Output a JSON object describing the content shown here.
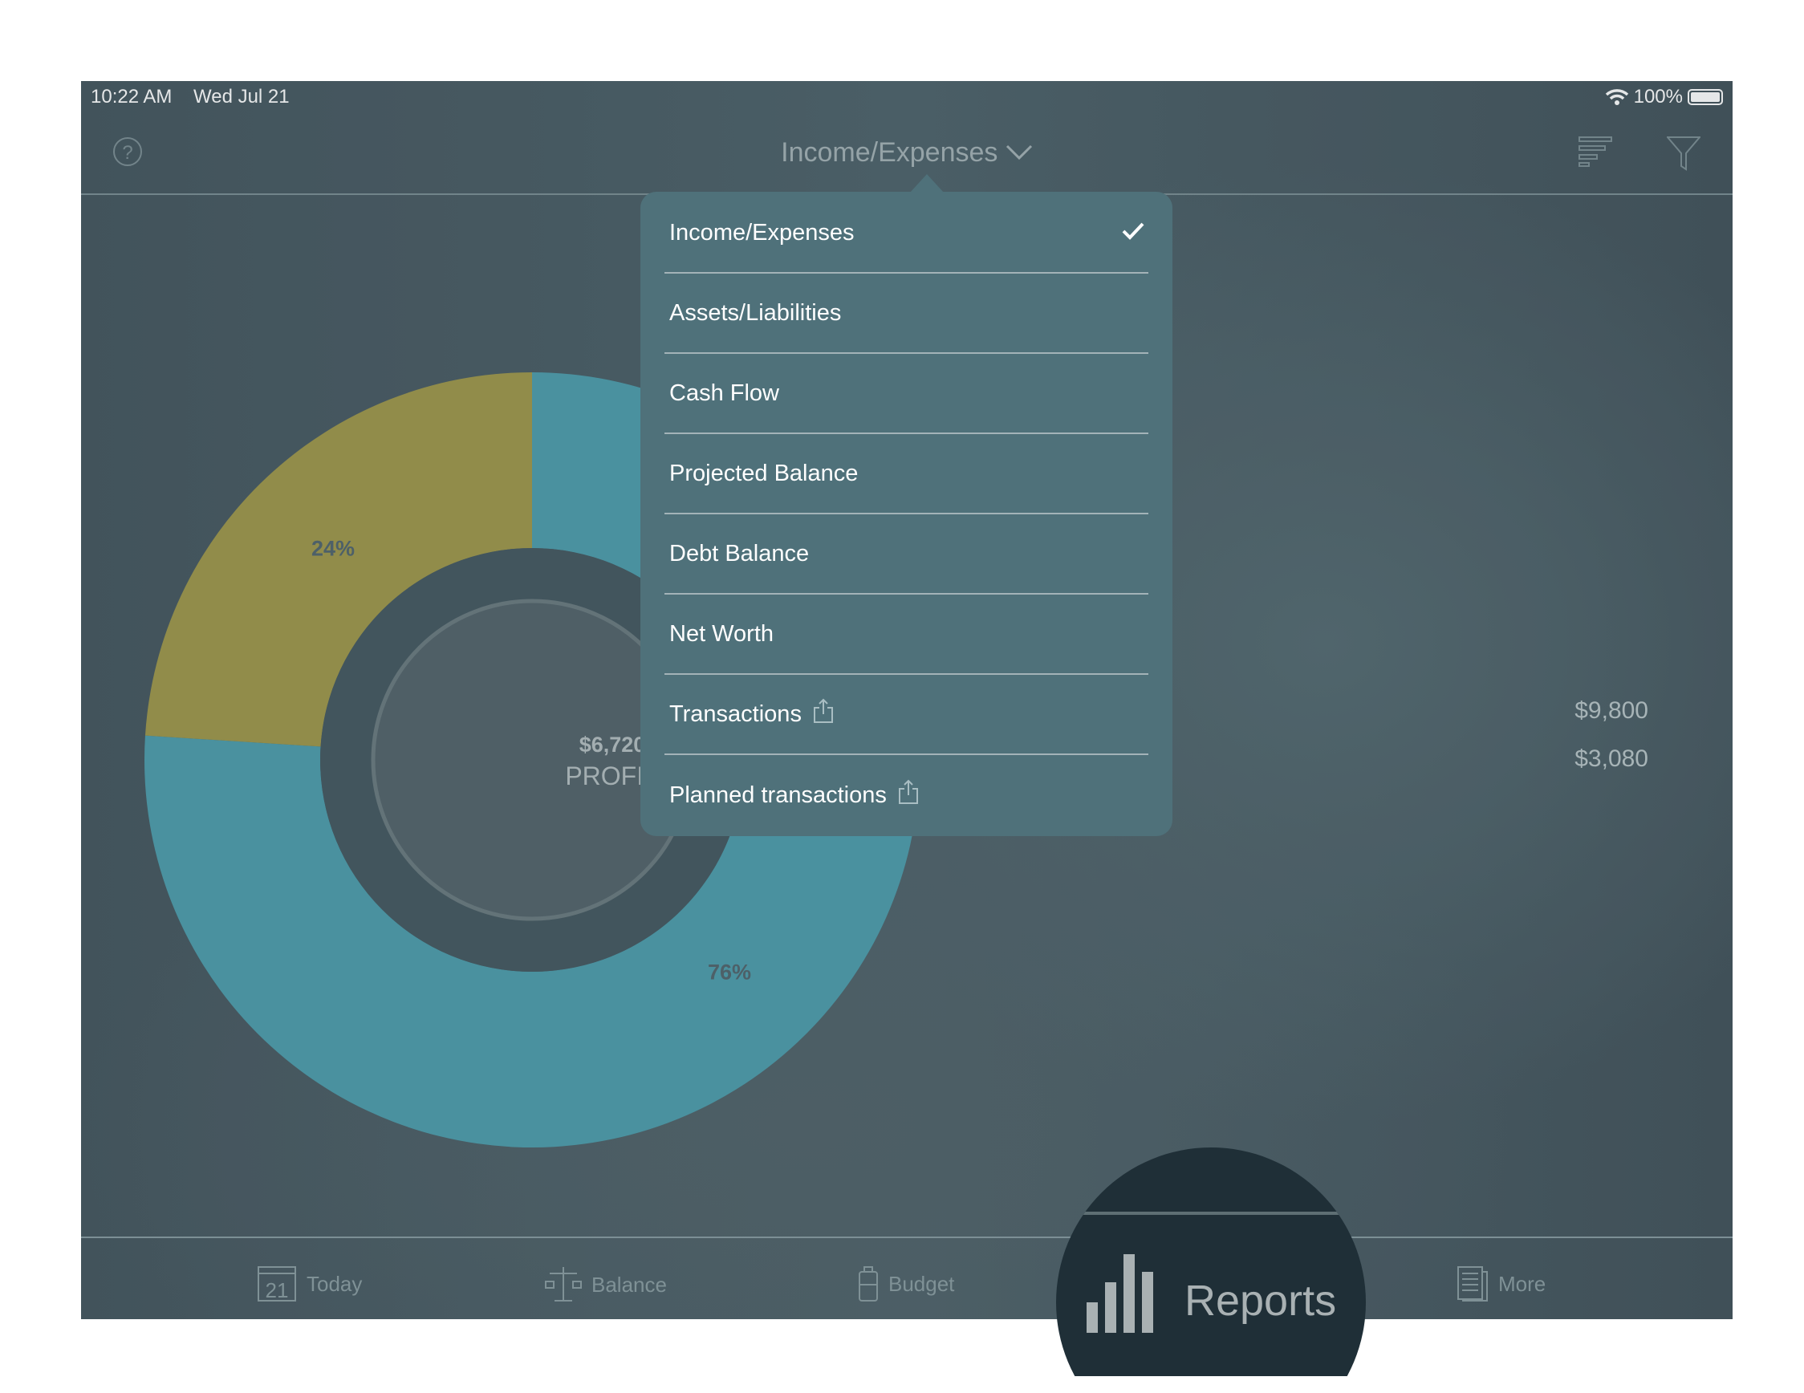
{
  "status_bar": {
    "time": "10:22 AM",
    "date": "Wed Jul 21",
    "battery": "100%",
    "battery_level": 1.0
  },
  "header": {
    "title": "Income/Expenses",
    "icons": [
      "help-icon",
      "sort-icon",
      "filter-icon",
      "chevron-down-icon"
    ]
  },
  "menu": {
    "items": [
      {
        "label": "Income/Expenses",
        "selected": true,
        "share": false
      },
      {
        "label": "Assets/Liabilities",
        "selected": false,
        "share": false
      },
      {
        "label": "Cash Flow",
        "selected": false,
        "share": false
      },
      {
        "label": "Projected Balance",
        "selected": false,
        "share": false
      },
      {
        "label": "Debt Balance",
        "selected": false,
        "share": false
      },
      {
        "label": "Net Worth",
        "selected": false,
        "share": false
      },
      {
        "label": "Transactions",
        "selected": false,
        "share": true
      },
      {
        "label": "Planned transactions",
        "selected": false,
        "share": true
      }
    ]
  },
  "chart_data": {
    "type": "pie",
    "donut": true,
    "slices": [
      {
        "label": "76%",
        "value": 76,
        "color": "#4f9eac"
      },
      {
        "label": "24%",
        "value": 24,
        "color": "#a0984c"
      }
    ],
    "center_value": "$6,720",
    "center_label": "PROFIT"
  },
  "summary": {
    "income": "$9,800",
    "expenses": "$3,080"
  },
  "tabs": [
    {
      "label": "Today",
      "icon": "calendar-icon",
      "badge": "21"
    },
    {
      "label": "Balance",
      "icon": "scale-icon"
    },
    {
      "label": "Budget",
      "icon": "jar-icon"
    },
    {
      "label": "Reports",
      "icon": "bar-chart-icon",
      "active": true
    },
    {
      "label": "More",
      "icon": "document-icon"
    }
  ]
}
